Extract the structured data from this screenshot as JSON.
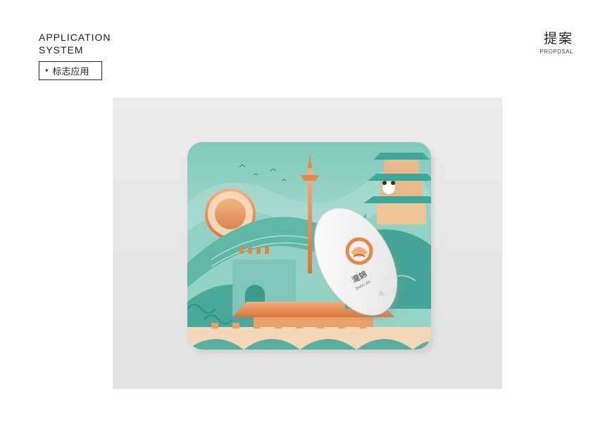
{
  "header": {
    "title_line1": "APPLICATION",
    "title_line2": "SYSTEM",
    "tag_label": "标志应用"
  },
  "proposal": {
    "title": "提案",
    "subtitle": "PROPDSAL"
  },
  "mockup": {
    "logo_text": "瀧錦",
    "logo_subtext": "ZHOU JIN",
    "colors": {
      "teal": "#3aa99a",
      "teal_light": "#8fd1c4",
      "orange": "#e08a45",
      "cream": "#f3e4cf"
    }
  }
}
